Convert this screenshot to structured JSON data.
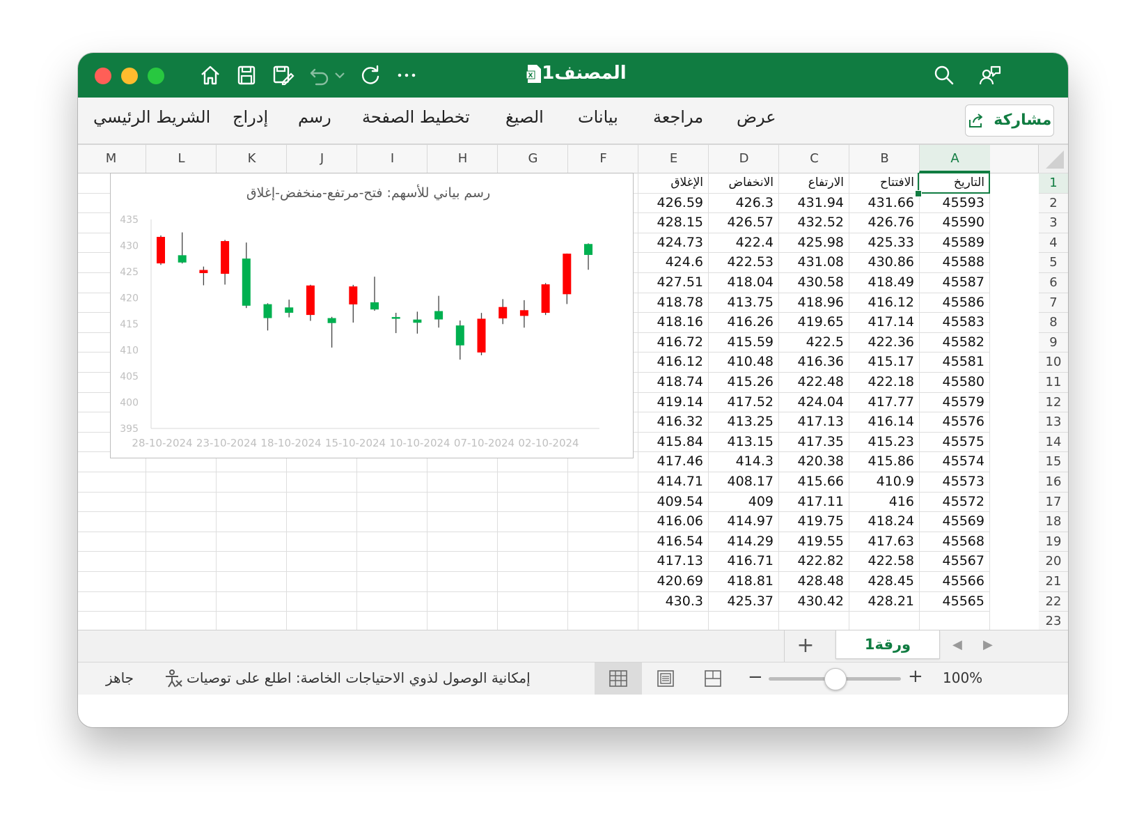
{
  "titlebar": {
    "title": "المصنف1",
    "icons": [
      "home-icon",
      "save-icon",
      "save-as-icon",
      "undo-icon",
      "chevron-down-icon",
      "redo-icon",
      "more-icon",
      "search-icon",
      "collaborate-icon"
    ]
  },
  "ribbon": {
    "tabs": [
      "الشريط الرئيسي",
      "إدراج",
      "رسم",
      "تخطيط الصفحة",
      "الصيغ",
      "بيانات",
      "مراجعة",
      "عرض"
    ],
    "share_label": "مشاركة"
  },
  "columns": [
    "M",
    "L",
    "K",
    "J",
    "I",
    "H",
    "G",
    "F",
    "E",
    "D",
    "C",
    "B",
    "A"
  ],
  "headers": {
    "A": "التاريخ",
    "B": "الافتتاح",
    "C": "الارتفاع",
    "D": "الانخفاض",
    "E": "الإغلاق"
  },
  "rows": [
    [
      "45593",
      "431.66",
      "431.94",
      "426.3",
      "426.59"
    ],
    [
      "45590",
      "426.76",
      "432.52",
      "426.57",
      "428.15"
    ],
    [
      "45589",
      "425.33",
      "425.98",
      "422.4",
      "424.73"
    ],
    [
      "45588",
      "430.86",
      "431.08",
      "422.53",
      "424.6"
    ],
    [
      "45587",
      "418.49",
      "430.58",
      "418.04",
      "427.51"
    ],
    [
      "45586",
      "416.12",
      "418.96",
      "413.75",
      "418.78"
    ],
    [
      "45583",
      "417.14",
      "419.65",
      "416.26",
      "418.16"
    ],
    [
      "45582",
      "422.36",
      "422.5",
      "415.59",
      "416.72"
    ],
    [
      "45581",
      "415.17",
      "416.36",
      "410.48",
      "416.12"
    ],
    [
      "45580",
      "422.18",
      "422.48",
      "415.26",
      "418.74"
    ],
    [
      "45579",
      "417.77",
      "424.04",
      "417.52",
      "419.14"
    ],
    [
      "45576",
      "416.14",
      "417.13",
      "413.25",
      "416.32"
    ],
    [
      "45575",
      "415.23",
      "417.35",
      "413.15",
      "415.84"
    ],
    [
      "45574",
      "415.86",
      "420.38",
      "414.3",
      "417.46"
    ],
    [
      "45573",
      "410.9",
      "415.66",
      "408.17",
      "414.71"
    ],
    [
      "45572",
      "416",
      "417.11",
      "409",
      "409.54"
    ],
    [
      "45569",
      "418.24",
      "419.75",
      "414.97",
      "416.06"
    ],
    [
      "45568",
      "417.63",
      "419.55",
      "414.29",
      "416.54"
    ],
    [
      "45567",
      "422.58",
      "422.82",
      "416.71",
      "417.13"
    ],
    [
      "45566",
      "428.45",
      "428.48",
      "418.81",
      "420.69"
    ],
    [
      "45565",
      "428.21",
      "430.42",
      "425.37",
      "430.3"
    ]
  ],
  "row_numbers": [
    "1",
    "2",
    "3",
    "4",
    "5",
    "6",
    "7",
    "8",
    "9",
    "10",
    "11",
    "12",
    "13",
    "14",
    "15",
    "16",
    "17",
    "18",
    "19",
    "20",
    "21",
    "22",
    "23"
  ],
  "chart_data": {
    "type": "candlestick",
    "title": "رسم بياني للأسهم: فتح-مرتفع-منخفض-إغلاق",
    "ylim": [
      395,
      435
    ],
    "y_ticks": [
      "435",
      "430",
      "425",
      "420",
      "415",
      "410",
      "405",
      "400",
      "395"
    ],
    "x_tick_labels": [
      "28-10-2024",
      "23-10-2024",
      "18-10-2024",
      "15-10-2024",
      "10-10-2024",
      "07-10-2024",
      "02-10-2024"
    ],
    "x_axis_reversed": true,
    "up_color": "#00b050",
    "down_color": "#ff0000",
    "series_order": "left-to-right from newest (28-10) to oldest (01-10)",
    "candles": [
      {
        "open": 431.66,
        "high": 431.94,
        "low": 426.3,
        "close": 426.59
      },
      {
        "open": 426.76,
        "high": 432.52,
        "low": 426.57,
        "close": 428.15
      },
      {
        "open": 425.33,
        "high": 425.98,
        "low": 422.4,
        "close": 424.73
      },
      {
        "open": 430.86,
        "high": 431.08,
        "low": 422.53,
        "close": 424.6
      },
      {
        "open": 418.49,
        "high": 430.58,
        "low": 418.04,
        "close": 427.51
      },
      {
        "open": 416.12,
        "high": 418.96,
        "low": 413.75,
        "close": 418.78
      },
      {
        "open": 417.14,
        "high": 419.65,
        "low": 416.26,
        "close": 418.16
      },
      {
        "open": 422.36,
        "high": 422.5,
        "low": 415.59,
        "close": 416.72
      },
      {
        "open": 415.17,
        "high": 416.36,
        "low": 410.48,
        "close": 416.12
      },
      {
        "open": 422.18,
        "high": 422.48,
        "low": 415.26,
        "close": 418.74
      },
      {
        "open": 417.77,
        "high": 424.04,
        "low": 417.52,
        "close": 419.14
      },
      {
        "open": 416.14,
        "high": 417.13,
        "low": 413.25,
        "close": 416.32
      },
      {
        "open": 415.23,
        "high": 417.35,
        "low": 413.15,
        "close": 415.84
      },
      {
        "open": 415.86,
        "high": 420.38,
        "low": 414.3,
        "close": 417.46
      },
      {
        "open": 410.9,
        "high": 415.66,
        "low": 408.17,
        "close": 414.71
      },
      {
        "open": 416,
        "high": 417.11,
        "low": 409,
        "close": 409.54
      },
      {
        "open": 418.24,
        "high": 419.75,
        "low": 414.97,
        "close": 416.06
      },
      {
        "open": 417.63,
        "high": 419.55,
        "low": 414.29,
        "close": 416.54
      },
      {
        "open": 422.58,
        "high": 422.82,
        "low": 416.71,
        "close": 417.13
      },
      {
        "open": 428.45,
        "high": 428.48,
        "low": 418.81,
        "close": 420.69
      },
      {
        "open": 428.21,
        "high": 430.42,
        "low": 425.37,
        "close": 430.3
      }
    ]
  },
  "sheet_tabs": {
    "add_label": "+",
    "active": "ورقة1"
  },
  "statusbar": {
    "ready": "جاهز",
    "accessibility": "إمكانية الوصول لذوي الاحتياجات الخاصة: اطلع على توصيات",
    "zoom": "100%",
    "zoom_minus": "−",
    "zoom_plus": "+"
  },
  "colors": {
    "brand": "#107c41",
    "grid": "#dedede"
  }
}
